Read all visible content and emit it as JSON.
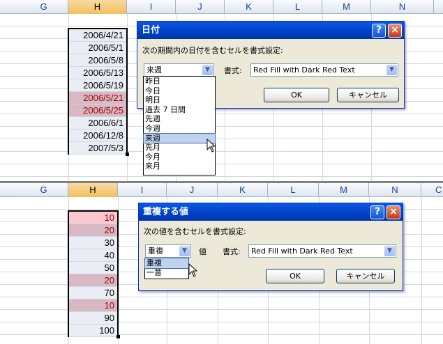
{
  "top": {
    "columns": [
      "G",
      "H",
      "I",
      "J",
      "K",
      "L",
      "M",
      "N"
    ],
    "selected_column": "H",
    "cells": [
      {
        "value": "2006/4/21",
        "style": "plain"
      },
      {
        "value": "2006/5/1",
        "style": "plain"
      },
      {
        "value": "2006/5/8",
        "style": "plain"
      },
      {
        "value": "2006/5/13",
        "style": "plain"
      },
      {
        "value": "2006/5/19",
        "style": "plain"
      },
      {
        "value": "2006/5/21",
        "style": "red"
      },
      {
        "value": "2006/5/25",
        "style": "red"
      },
      {
        "value": "2006/6/1",
        "style": "plain"
      },
      {
        "value": "2006/12/8",
        "style": "plain"
      },
      {
        "value": "2007/5/3",
        "style": "plain"
      }
    ],
    "dialog": {
      "title": "日付",
      "help": "?",
      "close": "×",
      "prompt": "次の期間内の日付を含むセルを書式設定:",
      "period_value": "来週",
      "format_label": "書式:",
      "format_value": "Red Fill with Dark Red Text",
      "ok": "OK",
      "cancel": "キャンセル",
      "options": [
        "昨日",
        "今日",
        "明日",
        "過去 7 日間",
        "先週",
        "今週",
        "来週",
        "先月",
        "今月",
        "来月"
      ],
      "highlighted": "来週"
    }
  },
  "bottom": {
    "columns": [
      "G",
      "H",
      "I",
      "J",
      "K",
      "L",
      "M",
      "N",
      "C"
    ],
    "selected_column": "H",
    "cells": [
      {
        "value": "10",
        "style": "pink"
      },
      {
        "value": "20",
        "style": "red"
      },
      {
        "value": "30",
        "style": "plain"
      },
      {
        "value": "40",
        "style": "plain"
      },
      {
        "value": "50",
        "style": "plain"
      },
      {
        "value": "20",
        "style": "red"
      },
      {
        "value": "70",
        "style": "plain"
      },
      {
        "value": "10",
        "style": "red"
      },
      {
        "value": "90",
        "style": "plain"
      },
      {
        "value": "100",
        "style": "plain"
      }
    ],
    "dialog": {
      "title": "重複する値",
      "help": "?",
      "close": "×",
      "prompt": "次の値を含むセルを書式設定:",
      "type_value": "重複",
      "value_label": "値",
      "format_label": "書式:",
      "format_value": "Red Fill with Dark Red Text",
      "ok": "OK",
      "cancel": "キャンセル",
      "options": [
        "重複",
        "一意"
      ],
      "highlighted": "重複"
    }
  },
  "colors": {
    "accent": "#0a58e5",
    "selected_header": "#f1c15f",
    "red_fill": "#d7b8c3",
    "dark_red_text": "#9c0006"
  }
}
